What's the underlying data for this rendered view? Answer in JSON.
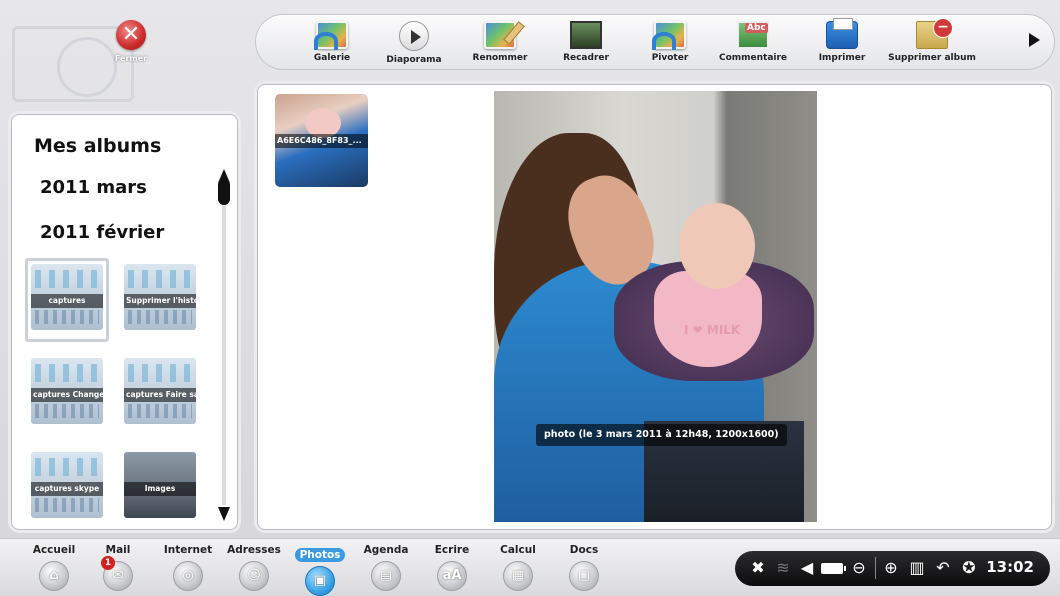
{
  "top": {
    "close_label": "Fermer"
  },
  "toolbar": {
    "items": [
      {
        "label": "Galerie",
        "icon": "gallery-icon"
      },
      {
        "label": "Diaporama",
        "icon": "play-icon"
      },
      {
        "label": "Renommer",
        "icon": "rename-icon"
      },
      {
        "label": "Recadrer",
        "icon": "crop-icon"
      },
      {
        "label": "Pivoter",
        "icon": "rotate-icon"
      },
      {
        "label": "Commentaire",
        "icon": "comment-icon",
        "icon_text": "Abc"
      },
      {
        "label": "Imprimer",
        "icon": "printer-icon"
      },
      {
        "label": "Supprimer album",
        "icon": "delete-album-icon"
      }
    ]
  },
  "albums": {
    "title": "Mes albums",
    "years": [
      "2011 mars",
      "2011 février"
    ],
    "thumbs": [
      {
        "caption": "captures"
      },
      {
        "caption": "Supprimer l'histo..."
      },
      {
        "caption": "captures Change..."
      },
      {
        "caption": "captures Faire sa..."
      },
      {
        "caption": "captures skype"
      },
      {
        "caption": "Images"
      }
    ]
  },
  "viewer": {
    "mini_caption": "A6E6C486_8F83_...",
    "bib_text": "I ❤ MILK",
    "photo_caption": "photo (le  3 mars 2011 à 12h48, 1200x1600)"
  },
  "dock": {
    "items": [
      {
        "label": "Accueil",
        "icon": "home-icon"
      },
      {
        "label": "Mail",
        "icon": "mail-icon",
        "badge": "1"
      },
      {
        "label": "Internet",
        "icon": "globe-icon"
      },
      {
        "label": "Adresses",
        "icon": "contacts-icon"
      },
      {
        "label": "Photos",
        "icon": "photos-icon",
        "active": true
      },
      {
        "label": "Agenda",
        "icon": "agenda-icon"
      },
      {
        "label": "Ecrire",
        "icon": "write-icon",
        "icon_text": "aA"
      },
      {
        "label": "Calcul",
        "icon": "calculator-icon"
      },
      {
        "label": "Docs",
        "icon": "docs-icon"
      }
    ]
  },
  "tray": {
    "time": "13:02"
  }
}
